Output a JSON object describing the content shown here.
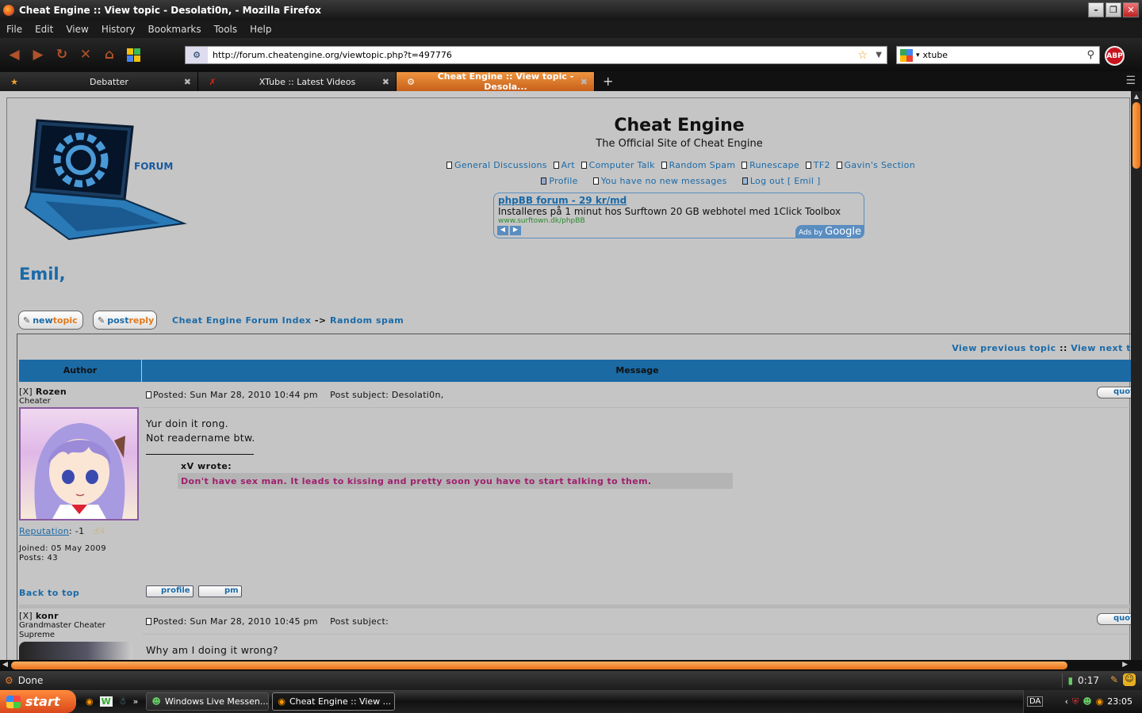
{
  "window": {
    "title": "Cheat Engine :: View topic - Desolati0n, - Mozilla Firefox",
    "buttons": {
      "minimize": "–",
      "maximize": "❐",
      "close": "✕"
    }
  },
  "menu": [
    "File",
    "Edit",
    "View",
    "History",
    "Bookmarks",
    "Tools",
    "Help"
  ],
  "nav": {
    "url": "http://forum.cheatengine.org/viewtopic.php?t=497776",
    "search_value": "xtube",
    "abp_label": "ABP"
  },
  "tabs": [
    {
      "label": "Debatter",
      "active": false
    },
    {
      "label": "XTube :: Latest Videos",
      "active": false
    },
    {
      "label": "Cheat Engine :: View topic - Desola...",
      "active": true
    }
  ],
  "site": {
    "logo_text": "FORUM",
    "title": "Cheat Engine",
    "subtitle": "The Official Site of Cheat Engine",
    "nav_links": [
      "General Discussions",
      "Art",
      "Computer Talk",
      "Random Spam",
      "Runescape",
      "TF2",
      "Gavin's Section"
    ],
    "user_links": [
      "Profile",
      "You have no new messages",
      "Log out [ Emil ]"
    ]
  },
  "ad": {
    "headline": "phpBB forum - 29 kr/md",
    "text": "Installeres på 1 minut hos Surftown 20 GB webhotel med 1Click Toolbox",
    "url": "www.surftown.dk/phpBB",
    "ads_by": "Ads by",
    "google": "Google"
  },
  "greeting": "Emil,",
  "buttons": {
    "new": "new",
    "topic": "topic",
    "post": "post",
    "reply": "reply"
  },
  "breadcrumb": {
    "index": "Cheat Engine Forum Index",
    "sep": "->",
    "forum": "Random spam"
  },
  "topic_nav": {
    "prev": "View previous topic",
    "sep": "::",
    "next": "View next t"
  },
  "table_headers": {
    "author": "Author",
    "message": "Message"
  },
  "posts": [
    {
      "flag": "[X]",
      "author": "Rozen",
      "rank": "Cheater",
      "posted": "Posted: Sun Mar 28, 2010 10:44 pm",
      "subject": "Post subject: Desolati0n,",
      "quote_btn": "quot",
      "body1": "Yur doin it rong.",
      "body2": "Not readername btw.",
      "quote_author": "xV wrote:",
      "quote_text": "Don't have sex man. It leads to kissing and pretty soon you have to start talking to them.",
      "reputation_label": "Reputation",
      "reputation_value": ": -1",
      "joined": "Joined: 05 May 2009",
      "posts": "Posts: 43",
      "back_to_top": "Back to top",
      "profile_btn": "profile",
      "pm_btn": "pm"
    },
    {
      "flag": "[X]",
      "author": "konr",
      "rank": "Grandmaster Cheater Supreme",
      "posted": "Posted: Sun Mar 28, 2010 10:45 pm",
      "subject": "Post subject:",
      "quote_btn": "quot",
      "body1": "Why am I doing it wrong?"
    }
  ],
  "status": {
    "text": "Done",
    "timer": "0:17"
  },
  "taskbar": {
    "start": "start",
    "tasks": [
      "Windows Live Messen...",
      "Cheat Engine :: View ..."
    ],
    "lang": "DA",
    "clock": "23:05"
  }
}
